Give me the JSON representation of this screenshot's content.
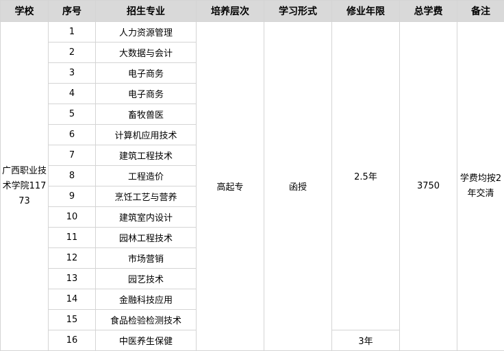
{
  "headers": [
    "学校",
    "序号",
    "招生专业",
    "培养层次",
    "学习形式",
    "修业年限",
    "总学费",
    "备注"
  ],
  "school": "广西职业技术学院11773",
  "level": "高起专",
  "study_mode": "函授",
  "duration_main": "2.5年",
  "duration_last": "3年",
  "total_fee": "3750",
  "remark": "学费均按2年交清",
  "rows": [
    {
      "no": "1",
      "major": "人力资源管理"
    },
    {
      "no": "2",
      "major": "大数据与会计"
    },
    {
      "no": "3",
      "major": "电子商务"
    },
    {
      "no": "4",
      "major": "电子商务"
    },
    {
      "no": "5",
      "major": "畜牧兽医"
    },
    {
      "no": "6",
      "major": "计算机应用技术"
    },
    {
      "no": "7",
      "major": "建筑工程技术"
    },
    {
      "no": "8",
      "major": "工程造价"
    },
    {
      "no": "9",
      "major": "烹饪工艺与营养"
    },
    {
      "no": "10",
      "major": "建筑室内设计"
    },
    {
      "no": "11",
      "major": "园林工程技术"
    },
    {
      "no": "12",
      "major": "市场营销"
    },
    {
      "no": "13",
      "major": "园艺技术"
    },
    {
      "no": "14",
      "major": "金融科技应用"
    },
    {
      "no": "15",
      "major": "食品检验检测技术"
    },
    {
      "no": "16",
      "major": "中医养生保健"
    }
  ]
}
